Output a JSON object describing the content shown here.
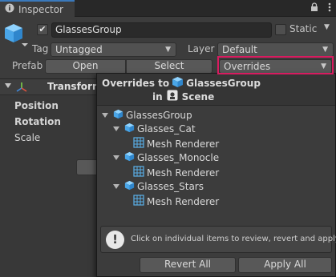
{
  "tab": {
    "title": "Inspector"
  },
  "header": {
    "object_name": "GlassesGroup",
    "active_check": "✔",
    "static_label": "Static",
    "tag_label": "Tag",
    "tag_value": "Untagged",
    "layer_label": "Layer",
    "layer_value": "Default",
    "prefab_label": "Prefab",
    "open_label": "Open",
    "select_label": "Select",
    "overrides_label": "Overrides"
  },
  "transform": {
    "title": "Transform",
    "position_label": "Position",
    "rotation_label": "Rotation",
    "scale_label": "Scale"
  },
  "popup": {
    "title_prefix": "Overrides to",
    "title_object": "GlassesGroup",
    "in_label": "in",
    "scene_label": "Scene",
    "tree": [
      {
        "label": "GlassesGroup",
        "type": "gameobject",
        "level": 0
      },
      {
        "label": "Glasses_Cat",
        "type": "gameobject",
        "level": 1
      },
      {
        "label": "Mesh Renderer",
        "type": "component",
        "level": 2
      },
      {
        "label": "Glasses_Monocle",
        "type": "gameobject",
        "level": 1
      },
      {
        "label": "Mesh Renderer",
        "type": "component",
        "level": 2
      },
      {
        "label": "Glasses_Stars",
        "type": "gameobject",
        "level": 1
      },
      {
        "label": "Mesh Renderer",
        "type": "component",
        "level": 2
      }
    ],
    "info_text": "Click on individual items to review, revert and apply.",
    "revert_all_label": "Revert All",
    "apply_all_label": "Apply All"
  },
  "colors": {
    "accent_tab": "#3a79bb",
    "highlight": "#d81b60",
    "cube": "#5fb7f0"
  }
}
